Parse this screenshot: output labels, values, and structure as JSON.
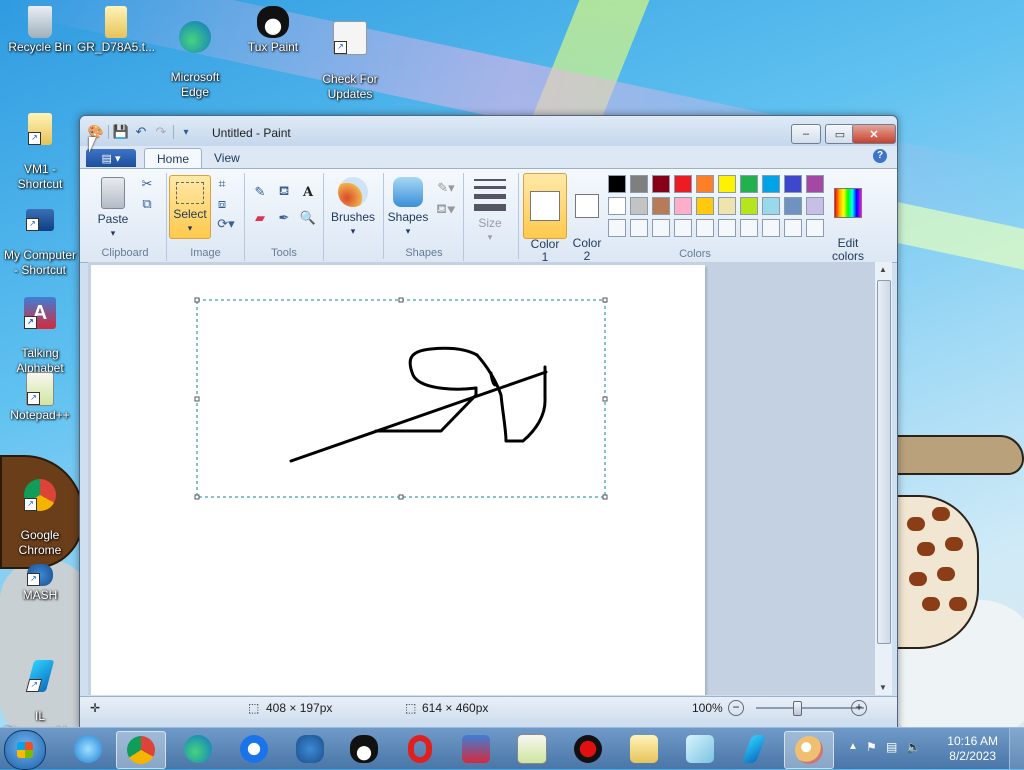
{
  "desktop": {
    "icons": [
      {
        "label": "Recycle Bin",
        "icon": "recycle-bin-icon"
      },
      {
        "label": "GR_D78A5.t...",
        "icon": "folder-icon"
      },
      {
        "label": "Microsoft\nEdge",
        "icon": "edge-icon"
      },
      {
        "label": "Tux Paint",
        "icon": "tux-icon"
      },
      {
        "label": "Check For\nUpdates",
        "icon": "java-update-icon"
      },
      {
        "label": "VM1 -\nShortcut",
        "icon": "folder-shortcut-icon"
      },
      {
        "label": "My Computer\n- Shortcut",
        "icon": "computer-icon"
      },
      {
        "label": "Talking\nAlphabet",
        "icon": "alphabet-icon"
      },
      {
        "label": "Notepad++",
        "icon": "notepadpp-icon"
      },
      {
        "label": "Google\nChrome",
        "icon": "chrome-icon"
      },
      {
        "label": "MASH",
        "icon": "mash-icon"
      },
      {
        "label": "IL\nDisassembl...",
        "icon": "il-disassembler-icon"
      }
    ]
  },
  "window": {
    "title": "Untitled - Paint",
    "tabs": [
      {
        "label": "Home"
      },
      {
        "label": "View"
      }
    ],
    "ribbon": {
      "clipboard": {
        "label": "Clipboard",
        "paste": "Paste"
      },
      "image": {
        "label": "Image",
        "select": "Select"
      },
      "tools": {
        "label": "Tools"
      },
      "brushes": "Brushes",
      "shapes": {
        "label": "Shapes",
        "button": "Shapes"
      },
      "size": "Size",
      "color1": "Color\n1",
      "color2": "Color\n2",
      "colors_label": "Colors",
      "edit_colors": "Edit\ncolors"
    },
    "palette_row1": [
      "#000000",
      "#7f7f7f",
      "#880015",
      "#ed1c24",
      "#ff7f27",
      "#fff200",
      "#22b14c",
      "#00a2e8",
      "#3f48cc",
      "#a349a4"
    ],
    "palette_row2": [
      "#ffffff",
      "#c3c3c3",
      "#b97a57",
      "#ffaec9",
      "#ffc90e",
      "#efe4b0",
      "#b5e61d",
      "#99d9ea",
      "#7092be",
      "#c8bfe7"
    ],
    "status": {
      "selection_size": "408 × 197px",
      "canvas_size": "614 × 460px",
      "zoom": "100%"
    }
  },
  "taskbar": {
    "time": "10:16 AM",
    "date": "8/2/2023",
    "apps": [
      "ie-icon",
      "chrome-icon",
      "edge-icon",
      "chrome-alt-icon",
      "mash-icon",
      "tux-icon",
      "opera-icon",
      "alphabet-icon",
      "notepadpp-icon",
      "record-icon",
      "explorer-icon",
      "notes-icon",
      "il-disassembler-icon",
      "paint-icon"
    ]
  }
}
